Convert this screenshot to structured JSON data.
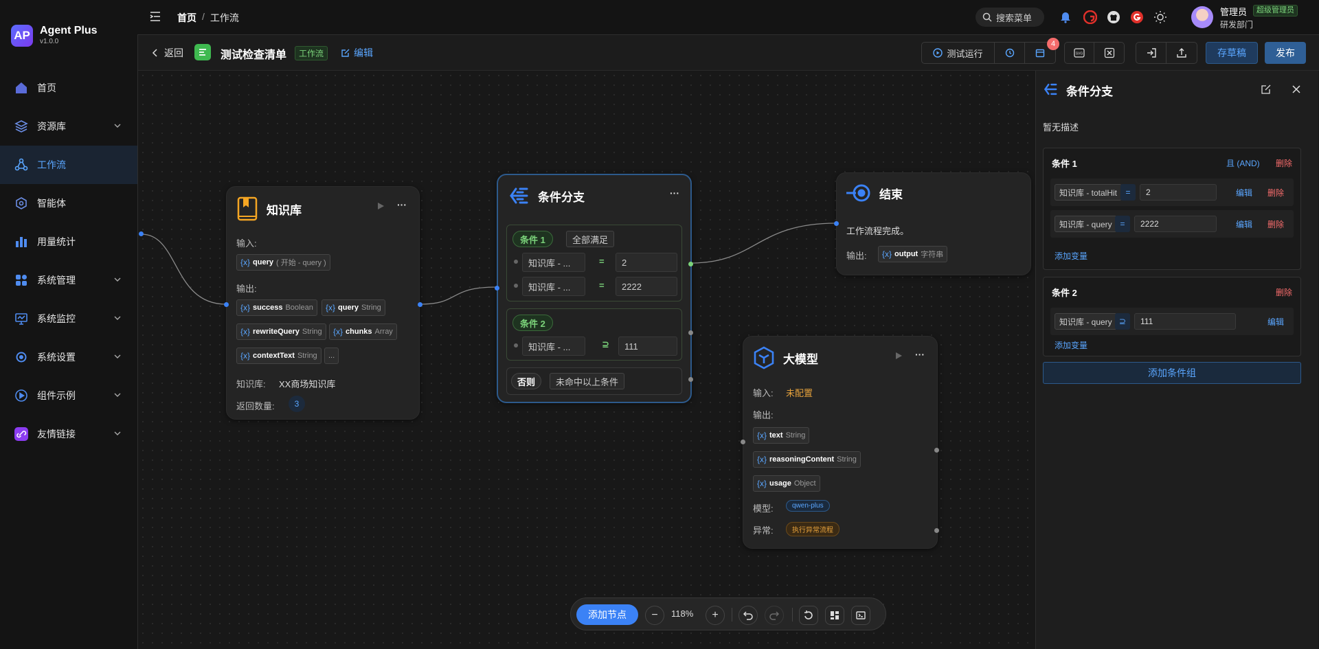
{
  "brand": {
    "name": "Agent Plus",
    "version": "v1.0.0",
    "logo_text": "AP"
  },
  "nav": {
    "items": [
      {
        "label": "首页",
        "icon": "home-icon",
        "expandable": false
      },
      {
        "label": "资源库",
        "icon": "layers-icon",
        "expandable": true
      },
      {
        "label": "工作流",
        "icon": "workflow-icon",
        "expandable": false,
        "active": true
      },
      {
        "label": "智能体",
        "icon": "agent-icon",
        "expandable": false
      },
      {
        "label": "用量统计",
        "icon": "bar-chart-icon",
        "expandable": false
      },
      {
        "label": "系统管理",
        "icon": "grid-icon",
        "expandable": true
      },
      {
        "label": "系统监控",
        "icon": "monitor-icon",
        "expandable": true
      },
      {
        "label": "系统设置",
        "icon": "settings-icon",
        "expandable": true
      },
      {
        "label": "组件示例",
        "icon": "play-circle-icon",
        "expandable": true
      },
      {
        "label": "友情链接",
        "icon": "link-icon",
        "expandable": true
      }
    ]
  },
  "topbar": {
    "breadcrumb": [
      "首页",
      "工作流"
    ],
    "breadcrumb_sep": "/",
    "search_label": "搜索菜单",
    "user": {
      "name": "管理员",
      "role_badge": "超级管理员",
      "dept": "研发部门"
    }
  },
  "toolbar": {
    "back_label": "返回",
    "title": "测试检查清单",
    "tag": "工作流",
    "edit_label": "编辑",
    "test_run_label": "测试运行",
    "badge_count": "4",
    "draft_label": "存草稿",
    "publish_label": "发布"
  },
  "nodes": {
    "knowledge": {
      "title": "知识库",
      "input_label": "输入:",
      "input_var": {
        "name": "query",
        "type": "( 开始 - query )"
      },
      "output_label": "输出:",
      "outputs": [
        {
          "name": "success",
          "type": "Boolean"
        },
        {
          "name": "query",
          "type": "String"
        },
        {
          "name": "rewriteQuery",
          "type": "String"
        },
        {
          "name": "chunks",
          "type": "Array"
        },
        {
          "name": "contextText",
          "type": "String"
        }
      ],
      "more_label": "...",
      "kb_label": "知识库:",
      "kb_value": "XX商场知识库",
      "count_label": "返回数量:",
      "count_value": "3"
    },
    "condition": {
      "title": "条件分支",
      "cond1_tag": "条件 1",
      "cond1_mode": "全部满足",
      "cond1_rows": [
        {
          "field": "知识库 - ...",
          "op": "=",
          "value": "2"
        },
        {
          "field": "知识库 - ...",
          "op": "=",
          "value": "2222"
        }
      ],
      "cond2_tag": "条件 2",
      "cond2_rows": [
        {
          "field": "知识库 - ...",
          "op": "⊇",
          "value": "111"
        }
      ],
      "else_tag": "否则",
      "else_text": "未命中以上条件"
    },
    "end": {
      "title": "结束",
      "desc": "工作流程完成。",
      "output_label": "输出:",
      "output_var": {
        "name": "output",
        "type": "字符串"
      }
    },
    "llm": {
      "title": "大模型",
      "input_label": "输入:",
      "input_value": "未配置",
      "output_label": "输出:",
      "outputs": [
        {
          "name": "text",
          "type": "String"
        },
        {
          "name": "reasoningContent",
          "type": "String"
        },
        {
          "name": "usage",
          "type": "Object"
        }
      ],
      "model_label": "模型:",
      "model_value": "qwen-plus",
      "error_label": "异常:",
      "error_value": "执行异常流程"
    }
  },
  "zoombar": {
    "add_node_label": "添加节点",
    "zoom": "118%",
    "minus": "−",
    "plus": "+"
  },
  "panel": {
    "title": "条件分支",
    "desc": "暂无描述",
    "group1": {
      "title": "条件 1",
      "logic": "且 (AND)",
      "delete_label": "删除",
      "rows": [
        {
          "field": "知识库 - totalHit",
          "op": "=",
          "value": "2",
          "edit": "编辑",
          "delete": "删除"
        },
        {
          "field": "知识库 - query",
          "op": "=",
          "value": "2222",
          "edit": "编辑",
          "delete": "删除"
        }
      ],
      "add_var_label": "添加变量"
    },
    "group2": {
      "title": "条件 2",
      "delete_label": "删除",
      "rows": [
        {
          "field": "知识库 - query",
          "op": "⊇",
          "value": "111",
          "edit": "编辑"
        }
      ],
      "add_var_label": "添加变量"
    },
    "add_group_label": "添加条件组"
  },
  "colors": {
    "accent": "#3b82f6",
    "success": "#7bd37a",
    "danger": "#f56c6c",
    "warning": "#e6a23c"
  }
}
